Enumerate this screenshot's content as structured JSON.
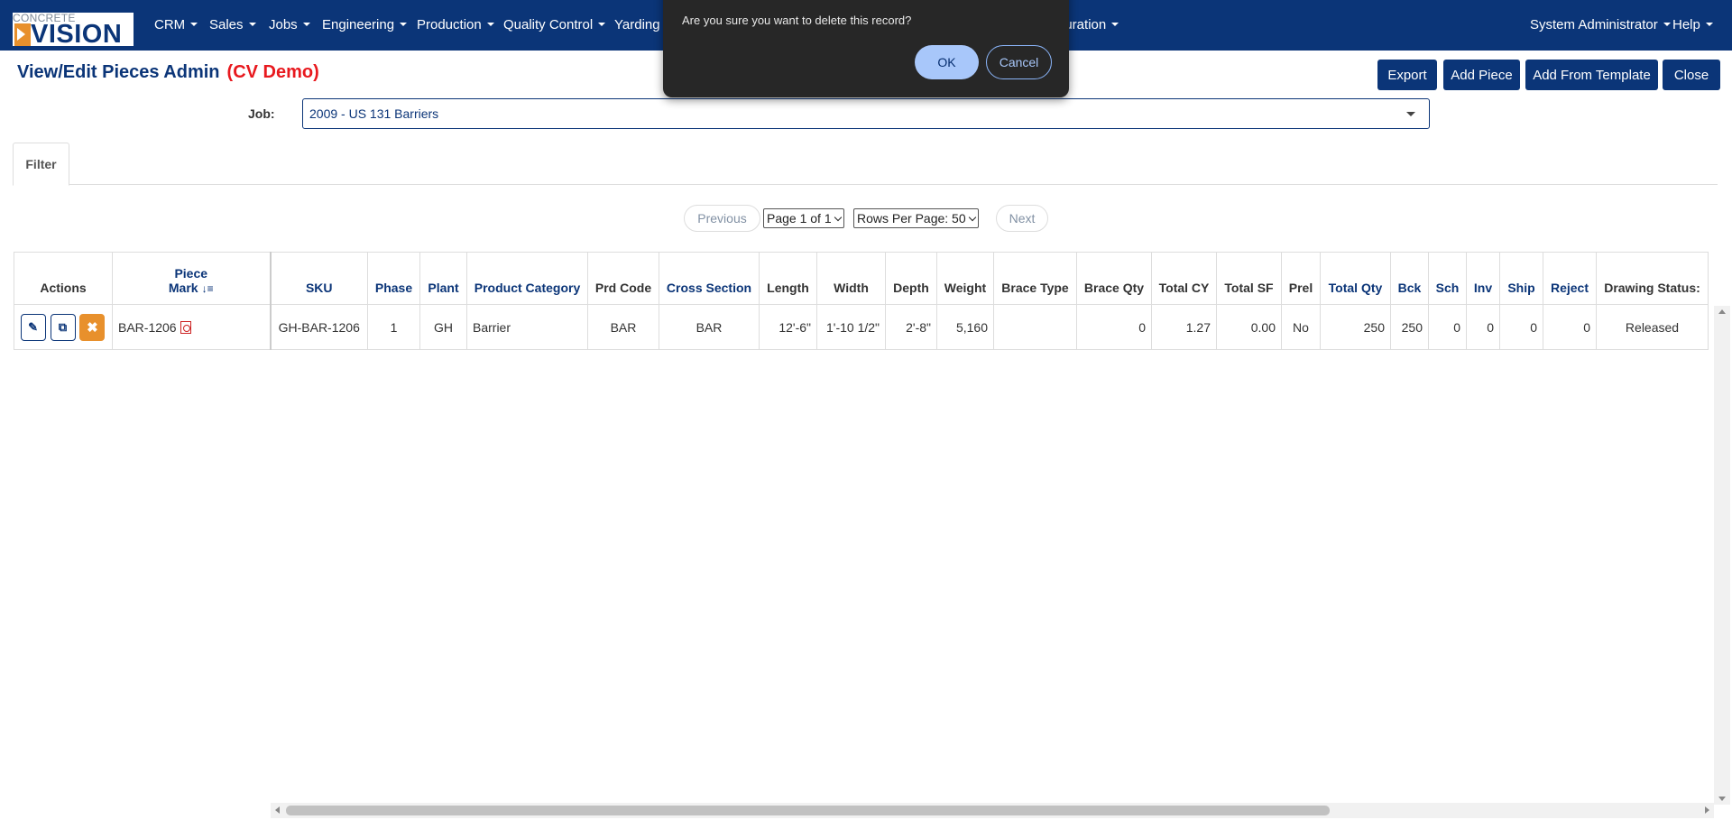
{
  "logo": {
    "top": "CONCRETE",
    "big": "VISION"
  },
  "nav": {
    "items": [
      "CRM",
      "Sales",
      "Jobs",
      "Engineering",
      "Production",
      "Quality Control",
      "Yarding",
      "guration"
    ],
    "user": "System Administrator",
    "help": "Help"
  },
  "page": {
    "title": "View/Edit Pieces Admin",
    "demo": "(CV Demo)"
  },
  "buttons": {
    "export": "Export",
    "add_piece": "Add Piece",
    "add_from_template": "Add From Template",
    "close": "Close"
  },
  "job": {
    "label": "Job:",
    "value": "2009 - US 131 Barriers"
  },
  "tabs": {
    "filter": "Filter"
  },
  "pager": {
    "previous": "Previous",
    "page": "Page 1 of 1",
    "rows": "Rows Per Page: 50",
    "next": "Next"
  },
  "table": {
    "headers": {
      "actions": "Actions",
      "piece_line1": "Piece",
      "piece_line2": "Mark",
      "sku": "SKU",
      "phase": "Phase",
      "plant": "Plant",
      "product_category": "Product Category",
      "prd_code": "Prd Code",
      "cross_section": "Cross Section",
      "length": "Length",
      "width": "Width",
      "depth": "Depth",
      "weight": "Weight",
      "brace_type": "Brace Type",
      "brace_qty": "Brace Qty",
      "total_cy": "Total CY",
      "total_sf": "Total SF",
      "prel": "Prel",
      "total_qty": "Total Qty",
      "bck": "Bck",
      "sch": "Sch",
      "inv": "Inv",
      "ship": "Ship",
      "reject": "Reject",
      "drawing_status": "Drawing Status:"
    },
    "rows": [
      {
        "piece_mark": "BAR-1206",
        "sku": "GH-BAR-1206",
        "phase": "1",
        "plant": "GH",
        "product_category": "Barrier",
        "prd_code": "BAR",
        "cross_section": "BAR",
        "length": "12'-6\"",
        "width": "1'-10 1/2\"",
        "depth": "2'-8\"",
        "weight": "5,160",
        "brace_type": "",
        "brace_qty": "0",
        "total_cy": "1.27",
        "total_sf": "0.00",
        "prel": "No",
        "total_qty": "250",
        "bck": "250",
        "sch": "0",
        "inv": "0",
        "ship": "0",
        "reject": "0",
        "drawing_status": "Released"
      }
    ]
  },
  "dialog": {
    "message": "Are you sure you want to delete this record?",
    "ok": "OK",
    "cancel": "Cancel"
  },
  "colors": {
    "navbar": "#0b3578",
    "accent_orange": "#e8902c",
    "demo_red": "#e8191e",
    "dialog_bg": "#272727"
  }
}
